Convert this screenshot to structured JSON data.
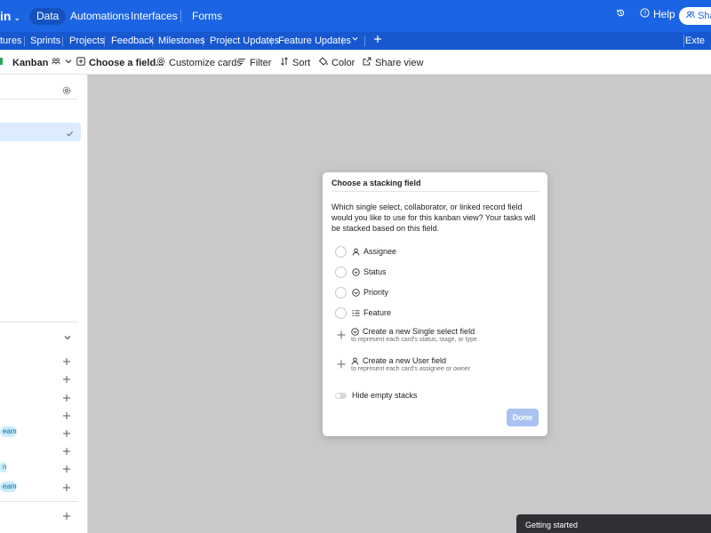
{
  "topbar": {
    "app_name": "in",
    "nav": [
      "Data",
      "Automations",
      "Interfaces",
      "Forms"
    ],
    "help_label": "Help",
    "share_label": "Share"
  },
  "tables": [
    "tures",
    "Sprints",
    "Projects",
    "Feedback",
    "Milestones",
    "Project Updates",
    "Feature Updates"
  ],
  "extensions_label": "Exte",
  "viewbar": {
    "view_name": "Kanban",
    "choose_field": "Choose a field...",
    "customize": "Customize cards",
    "filter": "Filter",
    "sort": "Sort",
    "color": "Color",
    "share_view": "Share view"
  },
  "sidebar": {
    "pills": [
      "eam",
      "n",
      "eam"
    ]
  },
  "modal": {
    "title": "Choose a stacking field",
    "description": "Which single select, collaborator, or linked record field would you like to use for this kanban view? Your tasks will be stacked based on this field.",
    "options": [
      {
        "label": "Assignee",
        "icon": "user-icon"
      },
      {
        "label": "Status",
        "icon": "single-select-icon"
      },
      {
        "label": "Priority",
        "icon": "single-select-icon"
      },
      {
        "label": "Feature",
        "icon": "linked-record-icon"
      }
    ],
    "create_options": [
      {
        "label": "Create a new Single select field",
        "sub": "to represent each card's status, stage, or type",
        "icon": "single-select-icon"
      },
      {
        "label": "Create a new User field",
        "sub": "to represent each card's assignee or owner",
        "icon": "user-icon"
      }
    ],
    "hide_empty": "Hide empty stacks",
    "done_label": "Done"
  },
  "getting_started": "Getting started",
  "colors": {
    "primary": "#1b64e4",
    "tables_bar": "#1758d0",
    "overlay": "#c9c9c9"
  }
}
